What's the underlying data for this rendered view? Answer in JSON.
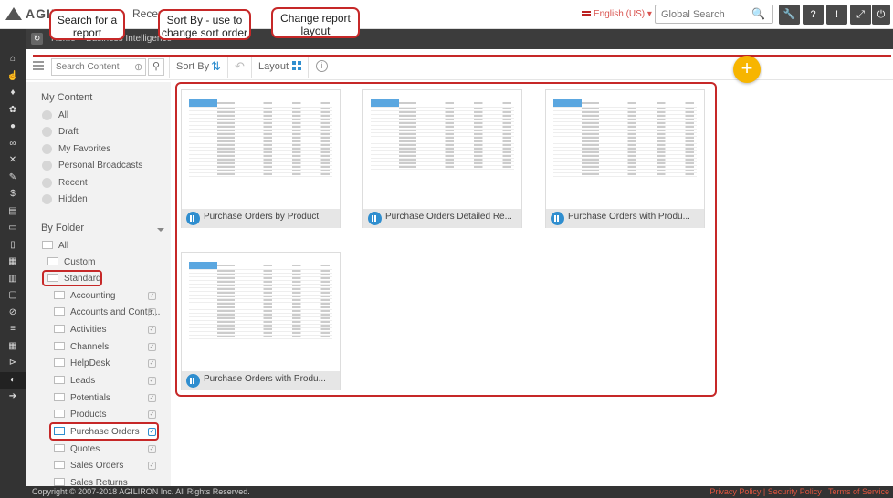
{
  "header": {
    "logo_text": "AGILIRON",
    "recent_link": "Recent",
    "language": "English (US)",
    "global_search_placeholder": "Global Search",
    "toolbar_icons": [
      "wrench-icon",
      "question-icon",
      "info-icon",
      "settings-icon",
      "expand-icon",
      "power-icon"
    ]
  },
  "breadcrumb": "Home > Business Intelligence",
  "toolbar": {
    "search_placeholder": "Search Content",
    "sort_label": "Sort By",
    "layout_label": "Layout"
  },
  "left_panel": {
    "my_content_title": "My Content",
    "my_content_items": [
      "All",
      "Draft",
      "My Favorites",
      "Personal Broadcasts",
      "Recent",
      "Hidden"
    ],
    "by_folder_title": "By Folder",
    "folders_top": [
      "All",
      "Custom",
      "Standard"
    ],
    "subfolders": [
      "Accounting",
      "Accounts and Conta...",
      "Activities",
      "Channels",
      "HelpDesk",
      "Leads",
      "Potentials",
      "Products",
      "Purchase Orders",
      "Quotes",
      "Sales Orders",
      "Sales Returns"
    ]
  },
  "reports": [
    {
      "name": "Purchase Orders by Product"
    },
    {
      "name": "Purchase Orders Detailed Re..."
    },
    {
      "name": "Purchase Orders with Produ..."
    },
    {
      "name": "Purchase Orders with Produ..."
    }
  ],
  "callouts": {
    "search": "Search for a report",
    "sort": "Sort By - use to change sort order",
    "layout": "Change report layout"
  },
  "footer": {
    "copyright": "Copyright © 2007-2018 AGILIRON Inc. All Rights Reserved.",
    "privacy": "Privacy Policy",
    "security": "Security Policy",
    "terms": "Terms of Service"
  },
  "colors": {
    "accent": "#2f8ecf",
    "annotation": "#c62828",
    "fab": "#f7b500"
  }
}
